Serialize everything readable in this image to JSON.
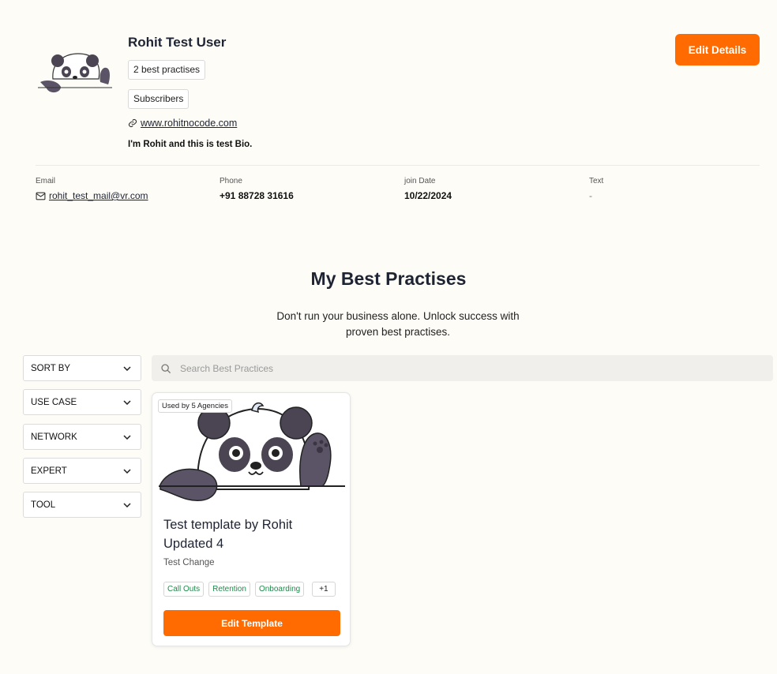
{
  "profile": {
    "name": "Rohit Test User",
    "chips": [
      "2 best practises",
      "Subscribers"
    ],
    "website": "www.rohitnocode.com",
    "bio": "I'm Rohit and this is test Bio.",
    "edit_label": "Edit Details"
  },
  "info": {
    "email_label": "Email",
    "email": "rohit_test_mail@vr.com",
    "phone_label": "Phone",
    "phone": "+91 88728 31616",
    "join_label": "join Date",
    "join_date": "10/22/2024",
    "text_label": "Text",
    "text_value": "-"
  },
  "section": {
    "title": "My Best Practises",
    "subtitle": "Don't run your business alone. Unlock success with proven best practises."
  },
  "filters": [
    "SORT BY",
    "USE CASE",
    "NETWORK",
    "EXPERT",
    "TOOL"
  ],
  "search": {
    "placeholder": "Search Best Practices"
  },
  "card": {
    "badge": "Used by 5 Agencies",
    "title": "Test template by Rohit Updated 4",
    "description": "Test Change",
    "tags": [
      "Call Outs",
      "Retention",
      "Onboarding"
    ],
    "more": "+1",
    "button": "Edit Template"
  },
  "colors": {
    "accent": "#ff6b00",
    "tag_text": "#1f8a4c",
    "background": "#fdfcf7"
  },
  "icons": {
    "link": "link-icon",
    "email": "mail-icon",
    "search": "search-icon",
    "chevron": "chevron-down-icon"
  }
}
